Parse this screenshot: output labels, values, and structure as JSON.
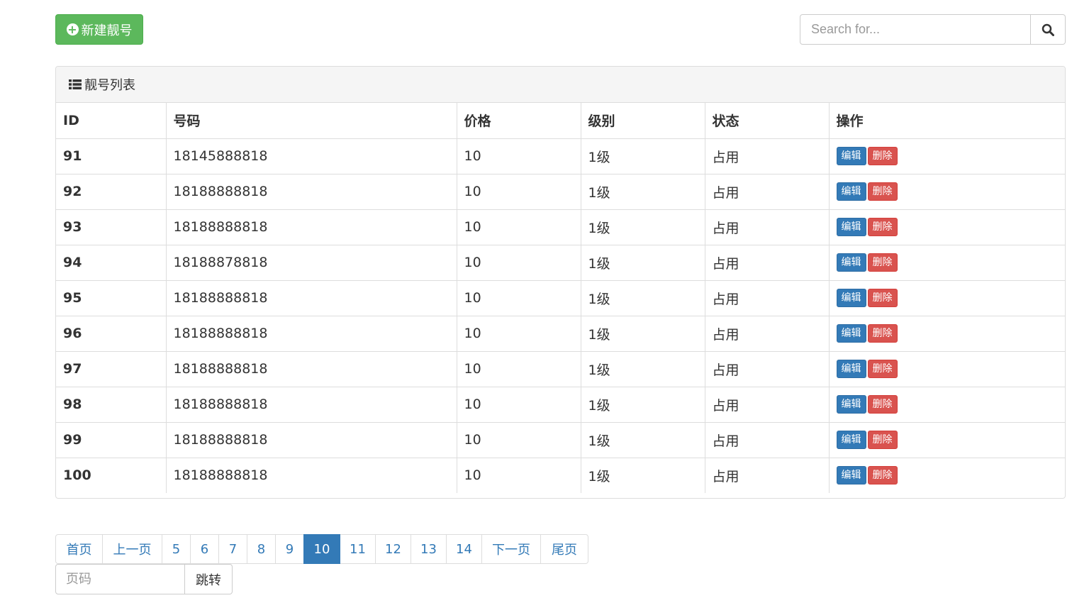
{
  "toolbar": {
    "new_label": "新建靓号"
  },
  "search": {
    "placeholder": "Search for..."
  },
  "panel": {
    "title": "靓号列表"
  },
  "table": {
    "headers": [
      "ID",
      "号码",
      "价格",
      "级别",
      "状态",
      "操作"
    ],
    "rows": [
      {
        "id": "91",
        "mobile": "18145888818",
        "price": "10",
        "level": "1级",
        "status": "占用"
      },
      {
        "id": "92",
        "mobile": "18188888818",
        "price": "10",
        "level": "1级",
        "status": "占用"
      },
      {
        "id": "93",
        "mobile": "18188888818",
        "price": "10",
        "level": "1级",
        "status": "占用"
      },
      {
        "id": "94",
        "mobile": "18188878818",
        "price": "10",
        "level": "1级",
        "status": "占用"
      },
      {
        "id": "95",
        "mobile": "18188888818",
        "price": "10",
        "level": "1级",
        "status": "占用"
      },
      {
        "id": "96",
        "mobile": "18188888818",
        "price": "10",
        "level": "1级",
        "status": "占用"
      },
      {
        "id": "97",
        "mobile": "18188888818",
        "price": "10",
        "level": "1级",
        "status": "占用"
      },
      {
        "id": "98",
        "mobile": "18188888818",
        "price": "10",
        "level": "1级",
        "status": "占用"
      },
      {
        "id": "99",
        "mobile": "18188888818",
        "price": "10",
        "level": "1级",
        "status": "占用"
      },
      {
        "id": "100",
        "mobile": "18188888818",
        "price": "10",
        "level": "1级",
        "status": "占用"
      }
    ],
    "edit_label": "编辑",
    "delete_label": "删除"
  },
  "pagination": {
    "items": [
      "首页",
      "上一页",
      "5",
      "6",
      "7",
      "8",
      "9",
      "10",
      "11",
      "12",
      "13",
      "14",
      "下一页",
      "尾页"
    ],
    "active": "10"
  },
  "jump": {
    "placeholder": "页码",
    "button_label": "跳转"
  }
}
